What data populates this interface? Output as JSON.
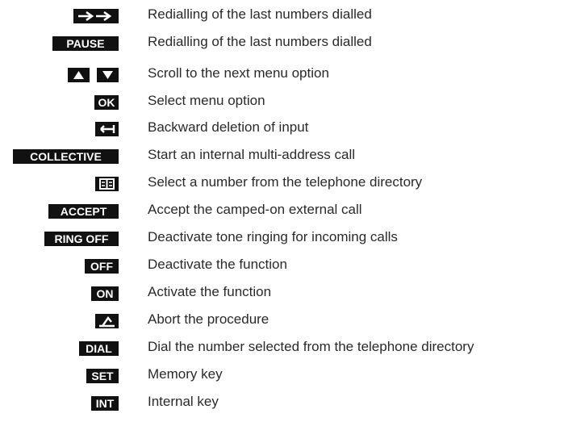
{
  "rows": [
    {
      "key": "→→",
      "desc": "Redialling of the last numbers dialled"
    },
    {
      "key": "PAUSE",
      "desc": "Redialling of the last numbers dialled"
    },
    {
      "key": "",
      "desc": "Scroll to the next menu option"
    },
    {
      "key": "OK",
      "desc": "Select menu option"
    },
    {
      "key": "",
      "desc": "Backward deletion of input"
    },
    {
      "key": "COLLECTIVE",
      "desc": "Start an internal multi-address call"
    },
    {
      "key": "",
      "desc": "Select a number from the telephone directory"
    },
    {
      "key": "ACCEPT",
      "desc": "Accept the camped-on external call"
    },
    {
      "key": "RING OFF",
      "desc": "Deactivate tone ringing for incoming calls"
    },
    {
      "key": "OFF",
      "desc": "Deactivate the function"
    },
    {
      "key": "ON",
      "desc": "Activate the function"
    },
    {
      "key": "",
      "desc": "Abort the procedure"
    },
    {
      "key": "DIAL",
      "desc": "Dial the number selected from the telephone directory"
    },
    {
      "key": "SET",
      "desc": "Memory key"
    },
    {
      "key": "INT",
      "desc": "Internal key"
    }
  ],
  "icons": {
    "row0": "redial-arrows-icon",
    "row2": "up-down-arrow-icons",
    "row4": "backspace-icon",
    "row6": "phonebook-icon",
    "row11": "on-hook-handset-icon"
  }
}
